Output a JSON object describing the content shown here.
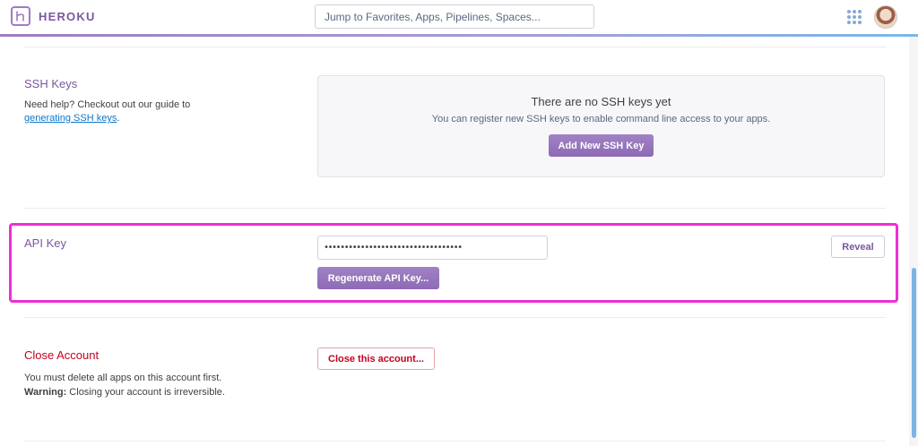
{
  "header": {
    "brand": "HEROKU",
    "search_placeholder": "Jump to Favorites, Apps, Pipelines, Spaces..."
  },
  "ssh_keys": {
    "title": "SSH Keys",
    "help_prefix": "Need help? Checkout out our guide to ",
    "help_link": "generating SSH keys",
    "help_suffix": ".",
    "empty_title": "There are no SSH keys yet",
    "empty_subtitle": "You can register new SSH keys to enable command line access to your apps.",
    "add_button": "Add New SSH Key"
  },
  "api_key": {
    "title": "API Key",
    "masked_value": "••••••••••••••••••••••••••••••••••",
    "reveal_button": "Reveal",
    "regenerate_button": "Regenerate API Key..."
  },
  "close_account": {
    "title": "Close Account",
    "line1": "You must delete all apps on this account first.",
    "warning_label": "Warning:",
    "warning_text": " Closing your account is irreversible.",
    "close_button": "Close this account..."
  },
  "colors": {
    "brand_purple": "#79589f",
    "danger_red": "#c6001f",
    "highlight_magenta": "#ee2fd5",
    "link_blue": "#0e76c9"
  }
}
